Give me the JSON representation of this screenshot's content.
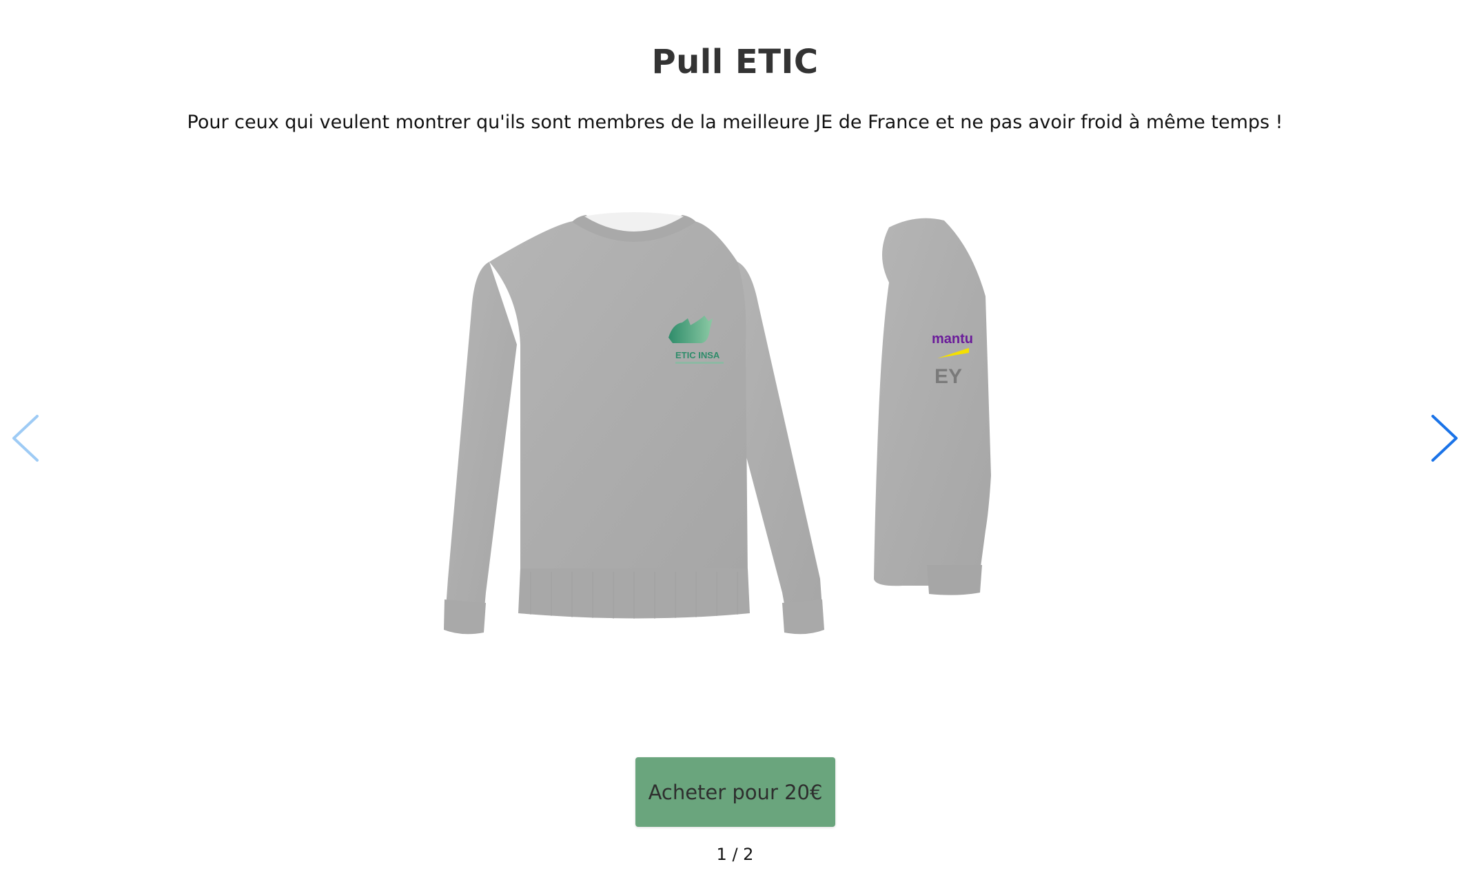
{
  "product": {
    "title": "Pull ETIC",
    "description": "Pour ceux qui veulent montrer qu'ils sont membres de la meilleure JE de France et ne pas avoir froid à même temps !",
    "front_logo_text": "ETIC INSA",
    "sleeve_logo_1": "mantu",
    "sleeve_logo_2": "EY"
  },
  "carousel": {
    "prev_icon": "chevron-left-icon",
    "next_icon": "chevron-right-icon",
    "pager": "1 / 2",
    "arrow_color_prev": "#9ecbf5",
    "arrow_color_next": "#1a73e8"
  },
  "buy": {
    "label": "Acheter pour 20€",
    "color": "#6aa57d"
  }
}
